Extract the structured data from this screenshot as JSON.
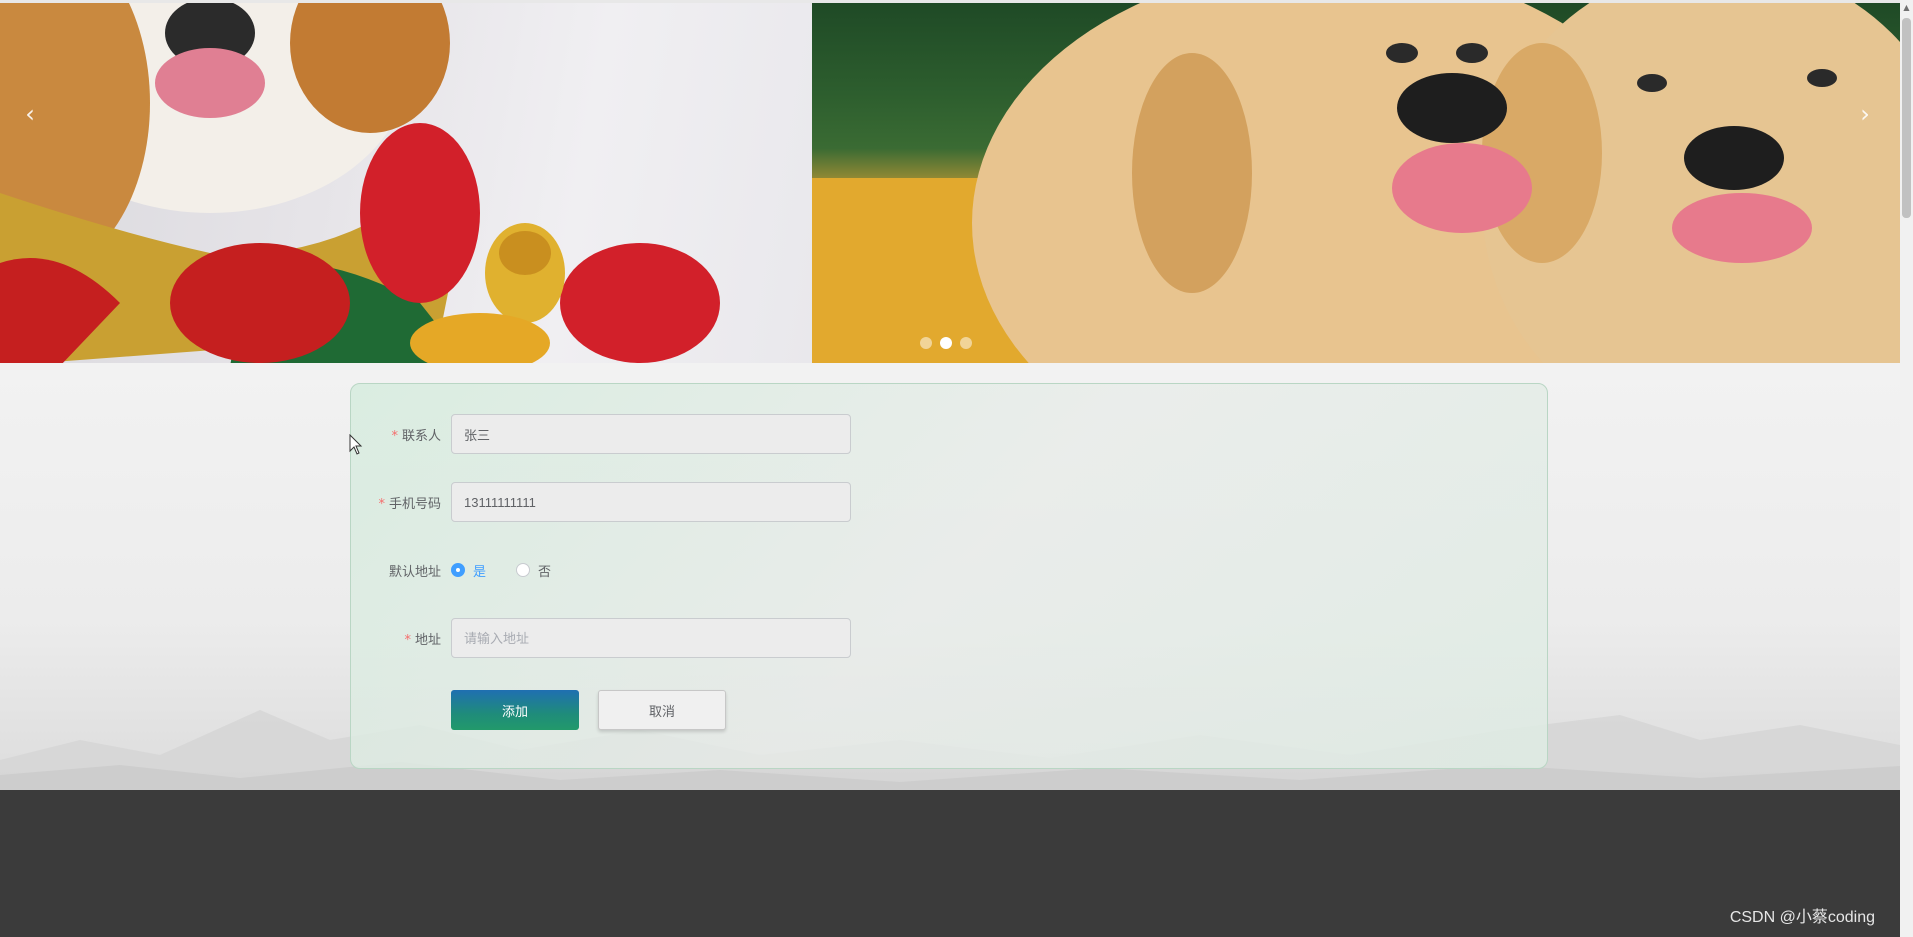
{
  "carousel": {
    "prev_label": "‹",
    "next_label": "›",
    "slide_count": 3,
    "active_slide": 2
  },
  "form": {
    "contact": {
      "label": "联系人",
      "value": "张三",
      "required": true
    },
    "phone": {
      "label": "手机号码",
      "value": "13111111111",
      "required": true
    },
    "default_address": {
      "label": "默认地址",
      "options": [
        {
          "label": "是",
          "checked": true
        },
        {
          "label": "否",
          "checked": false
        }
      ]
    },
    "address": {
      "label": "地址",
      "placeholder": "请输入地址",
      "value": "",
      "required": true
    },
    "submit_label": "添加",
    "cancel_label": "取消",
    "required_mark": "*"
  },
  "watermark": "CSDN @小蔡coding",
  "colors": {
    "primary": "#409eff",
    "required": "#f56c6c",
    "footer": "#3b3b3b"
  }
}
